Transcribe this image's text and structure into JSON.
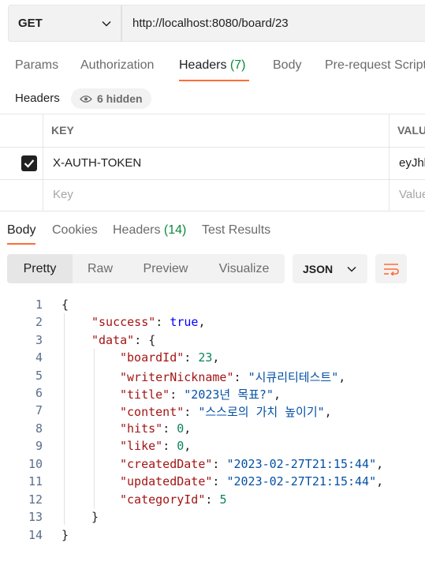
{
  "request": {
    "method": "GET",
    "url": "http://localhost:8080/board/23",
    "tabs": [
      {
        "label": "Params"
      },
      {
        "label": "Authorization"
      },
      {
        "label": "Headers ",
        "count": "(7)"
      },
      {
        "label": "Body"
      },
      {
        "label": "Pre-request Script"
      }
    ],
    "headers_label": "Headers",
    "hidden_label": "6 hidden",
    "table": {
      "col_key": "KEY",
      "col_value": "VALUE",
      "rows": [
        {
          "key": "X-AUTH-TOKEN",
          "value": "eyJhbG",
          "checked": true
        }
      ],
      "placeholder_key": "Key",
      "placeholder_value": "Value"
    }
  },
  "response": {
    "tabs": [
      {
        "label": "Body"
      },
      {
        "label": "Cookies"
      },
      {
        "label": "Headers ",
        "count": "(14)"
      },
      {
        "label": "Test Results"
      }
    ],
    "views": [
      "Pretty",
      "Raw",
      "Preview",
      "Visualize"
    ],
    "format": "JSON",
    "line_numbers": [
      "1",
      "2",
      "3",
      "4",
      "5",
      "6",
      "7",
      "8",
      "9",
      "10",
      "11",
      "12",
      "13",
      "14"
    ],
    "body": {
      "success": "true",
      "boardId": "23",
      "writerNickname": "\"시큐리티테스트\"",
      "title": "\"2023년 목표?\"",
      "content": "\"스스로의 가치 높이기\"",
      "hits": "0",
      "like": "0",
      "createdDate": "\"2023-02-27T21:15:44\"",
      "updatedDate": "\"2023-02-27T21:15:44\"",
      "categoryId": "5"
    },
    "keys": {
      "success": "\"success\"",
      "data": "\"data\"",
      "boardId": "\"boardId\"",
      "writerNickname": "\"writerNickname\"",
      "title": "\"title\"",
      "content": "\"content\"",
      "hits": "\"hits\"",
      "like": "\"like\"",
      "createdDate": "\"createdDate\"",
      "updatedDate": "\"updatedDate\"",
      "categoryId": "\"categoryId\""
    }
  }
}
